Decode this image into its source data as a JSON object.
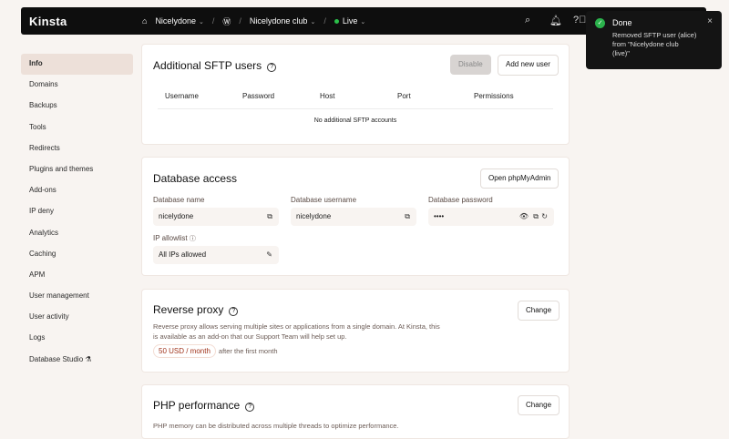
{
  "header": {
    "logo": "Kinsta",
    "company": "Nicelydone",
    "site": "Nicelydone club",
    "env": "Live",
    "sep": "/",
    "chev": "⌄"
  },
  "sidebar": {
    "items": [
      "Info",
      "Domains",
      "Backups",
      "Tools",
      "Redirects",
      "Plugins and themes",
      "Add-ons",
      "IP deny",
      "Analytics",
      "Caching",
      "APM",
      "User management",
      "User activity",
      "Logs",
      "Database Studio"
    ]
  },
  "sftp": {
    "title": "Additional SFTP users",
    "disable": "Disable",
    "add": "Add new user",
    "columns": [
      "Username",
      "Password",
      "Host",
      "Port",
      "Permissions"
    ],
    "empty": "No additional SFTP accounts"
  },
  "db": {
    "title": "Database access",
    "open": "Open phpMyAdmin",
    "name_label": "Database name",
    "name": "nicelydone",
    "user_label": "Database username",
    "user": "nicelydone",
    "pass_label": "Database password",
    "pass": "••••",
    "ip_label": "IP allowlist",
    "ip": "All IPs allowed"
  },
  "proxy": {
    "title": "Reverse proxy",
    "change": "Change",
    "desc1": "Reverse proxy allows serving multiple sites or applications from a single domain. At Kinsta, this",
    "desc2": "is available as an add-on that our Support Team will help set up.",
    "price": "50 USD / month",
    "after": "after the first month"
  },
  "php": {
    "title": "PHP performance",
    "change": "Change",
    "desc": "PHP memory can be distributed across multiple threads to optimize performance."
  },
  "toast": {
    "title": "Done",
    "line1": "Removed SFTP user (alice)",
    "line2": "from \"Nicelydone club",
    "line3": "(live)\"",
    "close": "×"
  },
  "help": "?"
}
